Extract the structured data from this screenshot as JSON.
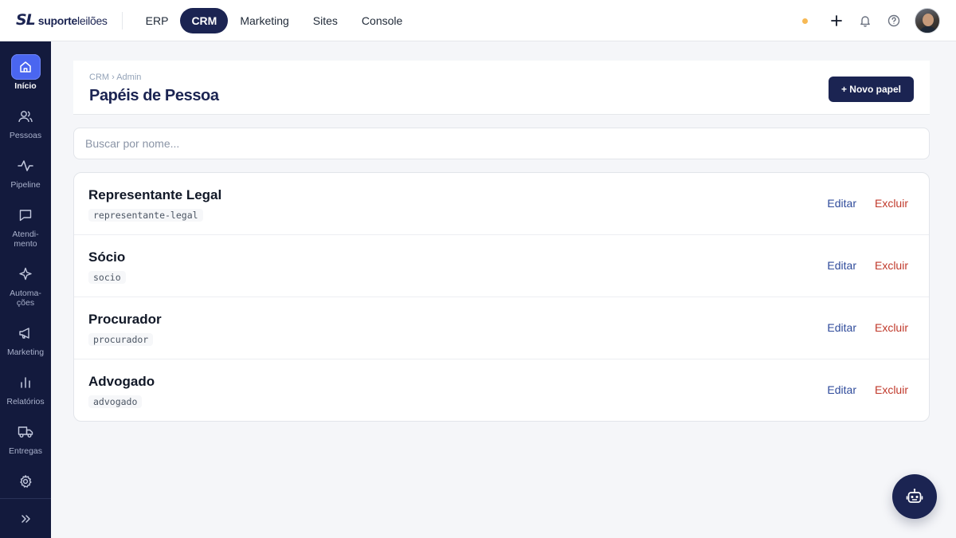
{
  "brand": {
    "mark": "SL",
    "name_bold": "suporte",
    "name_light": "leilões"
  },
  "top_nav": [
    {
      "label": "ERP",
      "active": false
    },
    {
      "label": "CRM",
      "active": true
    },
    {
      "label": "Marketing",
      "active": false
    },
    {
      "label": "Sites",
      "active": false
    },
    {
      "label": "Console",
      "active": false
    }
  ],
  "top_icons": [
    "plus-icon",
    "bell-icon",
    "help-icon"
  ],
  "sidebar": {
    "items": [
      {
        "label": "Início",
        "icon": "home-icon",
        "active": true
      },
      {
        "label": "Pessoas",
        "icon": "users-icon",
        "active": false
      },
      {
        "label": "Pipeline",
        "icon": "pulse-icon",
        "active": false
      },
      {
        "label": "Atendi-\nmento",
        "icon": "chat-icon",
        "active": false
      },
      {
        "label": "Automa-\nções",
        "icon": "sparkle-icon",
        "active": false
      },
      {
        "label": "Marketing",
        "icon": "megaphone-icon",
        "active": false
      },
      {
        "label": "Relatórios",
        "icon": "bar-chart-icon",
        "active": false
      },
      {
        "label": "Entregas",
        "icon": "truck-icon",
        "active": false
      },
      {
        "label": "",
        "icon": "gear-icon",
        "active": false
      }
    ],
    "footer_icon": "chevrons-right-icon"
  },
  "page": {
    "breadcrumb": "CRM › Admin",
    "title": "Papéis de Pessoa",
    "new_button": "+ Novo papel"
  },
  "search": {
    "placeholder": "Buscar por nome...",
    "value": ""
  },
  "roles": [
    {
      "name": "Representante Legal",
      "slug": "representante-legal",
      "edit": "Editar",
      "delete": "Excluir"
    },
    {
      "name": "Sócio",
      "slug": "socio",
      "edit": "Editar",
      "delete": "Excluir"
    },
    {
      "name": "Procurador",
      "slug": "procurador",
      "edit": "Editar",
      "delete": "Excluir"
    },
    {
      "name": "Advogado",
      "slug": "advogado",
      "edit": "Editar",
      "delete": "Excluir"
    }
  ],
  "colors": {
    "brand_navy": "#1b2452",
    "sidebar_bg": "#131a3d",
    "active_blue": "#4a66f0",
    "danger": "#c0392b",
    "link": "#2f4b9b",
    "status_dot": "#f7b955"
  },
  "fab_icon": "robot-icon"
}
